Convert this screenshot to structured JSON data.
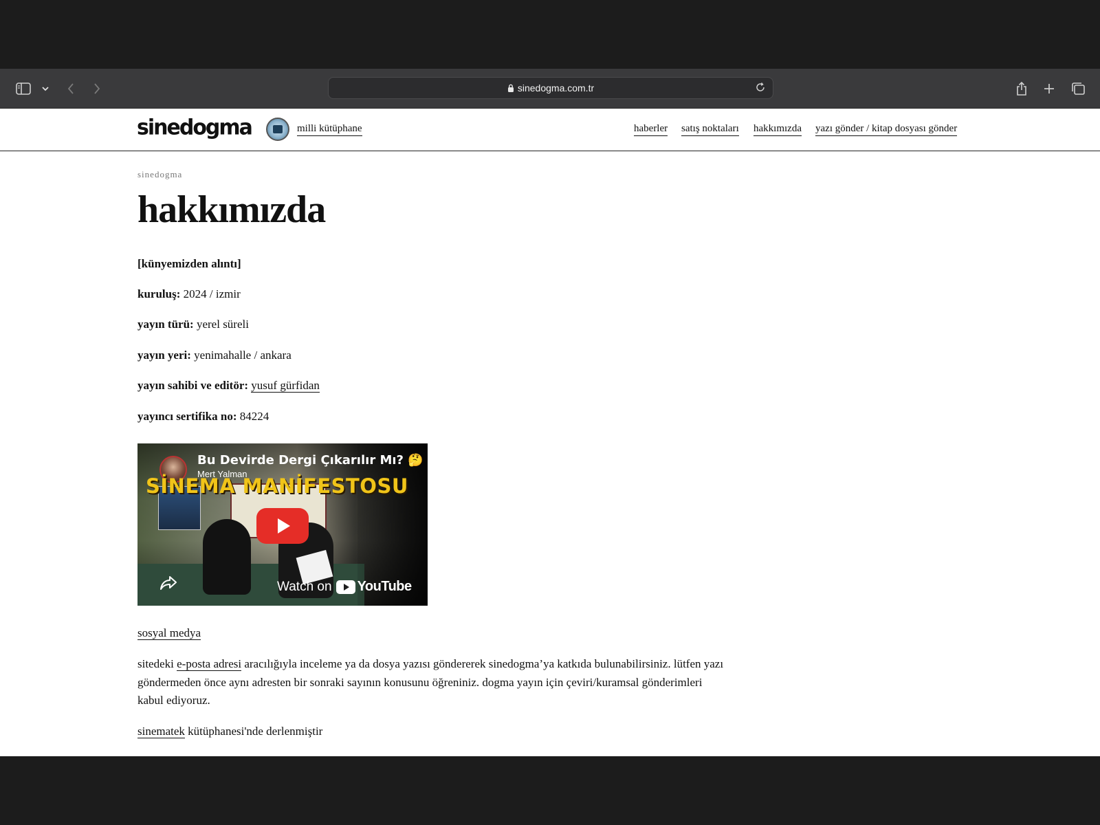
{
  "browser": {
    "url": "sinedogma.com.tr"
  },
  "site": {
    "logo": "sinedogma",
    "library_link": "milli kütüphane",
    "nav": [
      "haberler",
      "satış noktaları",
      "hakkımızda",
      "yazı gönder / kitap dosyası gönder"
    ]
  },
  "page": {
    "breadcrumb": "sinedogma",
    "title": "hakkımızda",
    "intro": "[künyemizden alıntı]",
    "details": [
      {
        "label": "kuruluş:",
        "value": "2024 / izmir"
      },
      {
        "label": "yayın türü:",
        "value": "yerel süreli"
      },
      {
        "label": "yayın yeri:",
        "value": "yenimahalle / ankara"
      },
      {
        "label": "yayın sahibi ve editör:",
        "value": "yusuf gürfidan"
      },
      {
        "label": "yayıncı sertifika no:",
        "value": "84224"
      }
    ],
    "video": {
      "title": "Bu Devirde Dergi Çıkarılır Mı? 🤔",
      "channel": "Mert Yalman",
      "banner": "SİNEMA MANİFESTOSU",
      "watch_label": "Watch on",
      "platform": "YouTube"
    },
    "social_link": "sosyal medya",
    "contrib": {
      "before": "sitedeki ",
      "link": "e-posta adresi",
      "after": " aracılığıyla inceleme ya da dosya yazısı göndererek sinedogma’ya katkıda bulunabilirsiniz. lütfen yazı göndermeden önce aynı adresten bir sonraki sayının konusunu öğreniniz. dogma yayın için çeviri/kuramsal gönderimleri kabul ediyoruz."
    },
    "footer": {
      "link": "sinematek",
      "text": " kütüphanesi'nde derlenmiştir"
    }
  }
}
